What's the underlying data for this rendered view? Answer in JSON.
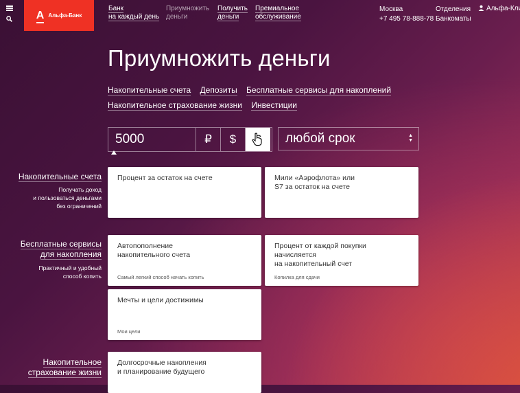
{
  "header": {
    "logo_mark": "А",
    "logo_name": "Альфа-Банк",
    "nav": [
      {
        "line1": "Банк",
        "line2": "на каждый день",
        "active": false
      },
      {
        "line1": "Приумножить",
        "line2": "деньги",
        "active": true
      },
      {
        "line1": "Получить",
        "line2": "деньги",
        "active": false
      },
      {
        "line1": "Премиальное",
        "line2": "обслуживание",
        "active": false
      }
    ],
    "city": "Москва",
    "phone": "+7 495 78-888-78",
    "offices": "Отделения",
    "atms": "Банкоматы",
    "alfa_click": "Альфа-Клик"
  },
  "page": {
    "title": "Приумножить деньги",
    "categories": [
      "Накопительные счета",
      "Депозиты",
      "Бесплатные сервисы для накоплений",
      "Накопительное страхование жизни",
      "Инвестиции"
    ]
  },
  "calculator": {
    "amount": "5000",
    "currencies": [
      "₽",
      "$",
      "€"
    ],
    "selected_currency": "€",
    "term": "любой срок"
  },
  "sections": [
    {
      "title_lines": [
        "Накопительные счета"
      ],
      "desc_lines": [
        "Получать доход",
        "и пользоваться деньгами",
        "без ограничений"
      ],
      "cards": [
        {
          "title_lines": [
            "Процент за остаток на счете"
          ],
          "subtitle": ""
        },
        {
          "title_lines": [
            "Мили «Аэрофлота» или",
            "S7 за остаток на счете"
          ],
          "subtitle": ""
        }
      ]
    },
    {
      "title_lines": [
        "Бесплатные сервисы",
        "для накопления"
      ],
      "desc_lines": [
        "Практичный и удобный",
        "способ копить"
      ],
      "cards": [
        {
          "title_lines": [
            "Автопополнение",
            "накопительного счета"
          ],
          "subtitle": "Самый легкий способ начать копить"
        },
        {
          "title_lines": [
            "Процент от каждой покупки",
            "начисляется",
            "на накопительный счет"
          ],
          "subtitle": "Копилка для сдачи"
        },
        {
          "title_lines": [
            "Мечты и цели достижимы"
          ],
          "subtitle": "Мои цели"
        }
      ]
    },
    {
      "title_lines": [
        "Накопительное",
        "страхование жизни"
      ],
      "desc_lines": [],
      "cards": [
        {
          "title_lines": [
            "Долгосрочные накопления",
            "и планирование будущего"
          ],
          "subtitle": ""
        }
      ]
    }
  ]
}
